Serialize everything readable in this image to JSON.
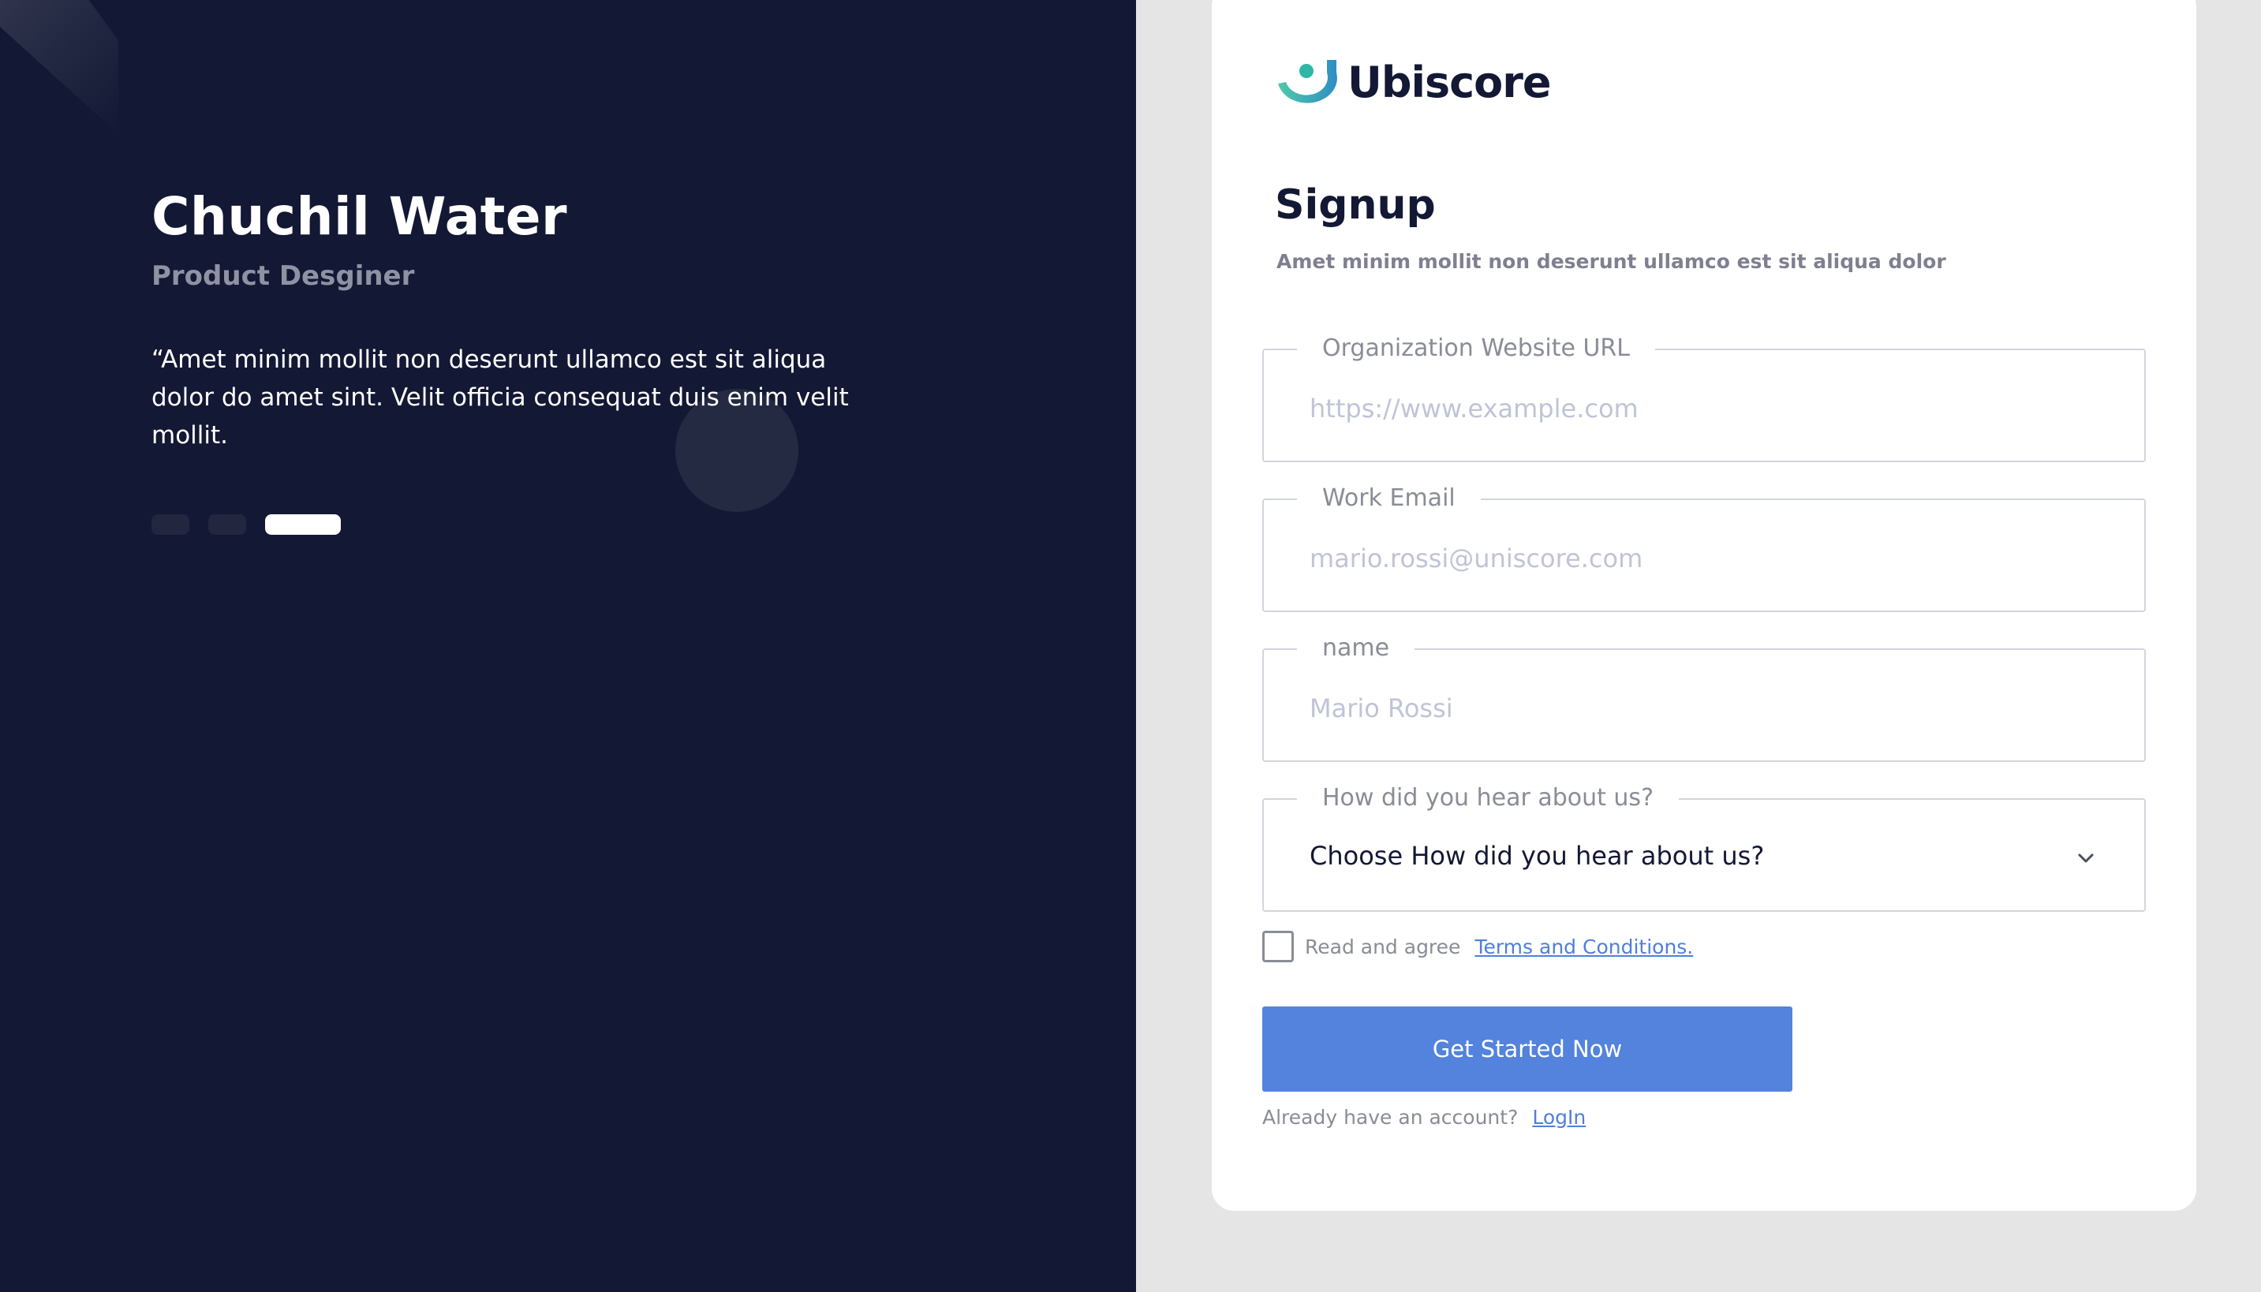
{
  "testimonial": {
    "name": "Chuchil Water",
    "role": "Product Desginer",
    "quote": "“Amet minim mollit non deserunt ullamco est sit aliqua dolor do amet sint. Velit officia consequat duis enim velit mollit."
  },
  "carousel": {
    "count": 3,
    "active_index": 2
  },
  "brand": {
    "name": "Ubiscore",
    "accent": "#5383dc",
    "dark": "#131834"
  },
  "form": {
    "title": "Signup",
    "subtitle": "Amet minim mollit non deserunt ullamco est sit aliqua dolor",
    "fields": [
      {
        "label": "Organization Website URL",
        "placeholder": "https://www.example.com",
        "value": ""
      },
      {
        "label": "Work Email",
        "placeholder": "mario.rossi@uniscore.com",
        "value": ""
      },
      {
        "label": "name",
        "placeholder": "Mario Rossi",
        "value": ""
      }
    ],
    "referral": {
      "label": "How did you hear about us?",
      "selected": "Choose How did you hear about us?"
    },
    "agree_text": "Read and agree",
    "terms_link": "Terms and Conditions.",
    "agree_checked": false,
    "submit_label": "Get Started Now",
    "already_text": "Already have an account?",
    "login_link": "LogIn"
  }
}
